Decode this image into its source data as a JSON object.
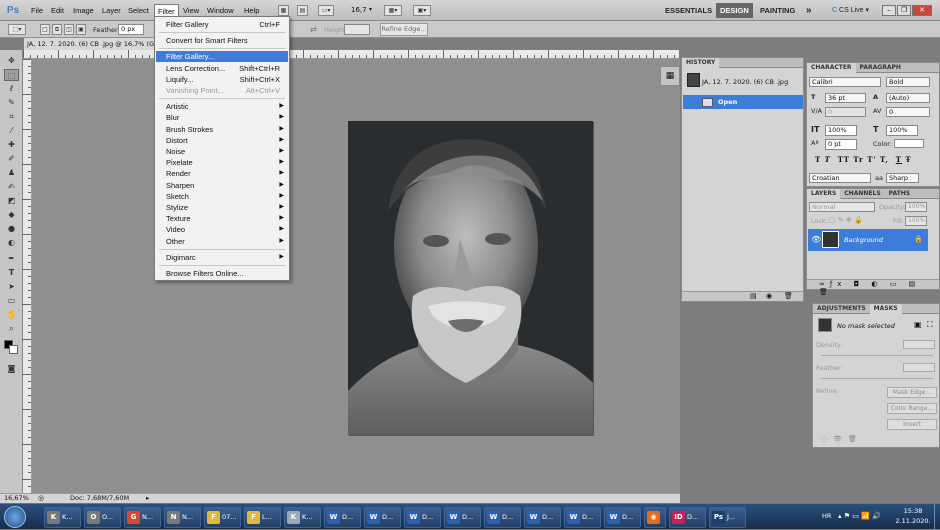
{
  "app": {
    "logo": "Ps"
  },
  "menu": [
    "File",
    "Edit",
    "Image",
    "Layer",
    "Select",
    "Filter",
    "View",
    "Window",
    "Help"
  ],
  "menu_active": "Filter",
  "toolbar_top": {
    "zoom": "16,7",
    "workspaces": [
      "ESSENTIALS",
      "DESIGN",
      "PAINTING"
    ],
    "active_workspace": "DESIGN",
    "more": "»",
    "cs_live": "CS Live"
  },
  "options": {
    "feather_label": "Feather:",
    "feather_value": "0 px",
    "height_label": "Height:",
    "refine_edge": "Refine Edge..."
  },
  "document": {
    "tab_title": "JA, 12. 7. 2020. (6) CB .jpg @ 16,7% (Gray/8)"
  },
  "filter_menu": [
    {
      "label": "Filter Gallery",
      "shortcut": "Ctrl+F"
    },
    {
      "sep": true
    },
    {
      "label": "Convert for Smart Filters"
    },
    {
      "sep": true
    },
    {
      "label": "Filter Gallery...",
      "highlight": true
    },
    {
      "label": "Lens Correction...",
      "shortcut": "Shift+Ctrl+R"
    },
    {
      "label": "Liquify...",
      "shortcut": "Shift+Ctrl+X"
    },
    {
      "label": "Vanishing Point...",
      "shortcut": "Alt+Ctrl+V",
      "disabled": true
    },
    {
      "sep": true
    },
    {
      "label": "Artistic",
      "sub": true
    },
    {
      "label": "Blur",
      "sub": true
    },
    {
      "label": "Brush Strokes",
      "sub": true
    },
    {
      "label": "Distort",
      "sub": true
    },
    {
      "label": "Noise",
      "sub": true
    },
    {
      "label": "Pixelate",
      "sub": true
    },
    {
      "label": "Render",
      "sub": true
    },
    {
      "label": "Sharpen",
      "sub": true
    },
    {
      "label": "Sketch",
      "sub": true
    },
    {
      "label": "Stylize",
      "sub": true
    },
    {
      "label": "Texture",
      "sub": true
    },
    {
      "label": "Video",
      "sub": true
    },
    {
      "label": "Other",
      "sub": true
    },
    {
      "sep": true
    },
    {
      "label": "Digimarc",
      "sub": true
    },
    {
      "sep": true
    },
    {
      "label": "Browse Filters Online..."
    }
  ],
  "history": {
    "tab": "HISTORY",
    "snapshot": "JA, 12. 7. 2020. (6) CB .jpg",
    "state": "Open"
  },
  "character": {
    "tabs": [
      "CHARACTER",
      "PARAGRAPH"
    ],
    "font": "Calibri",
    "style": "Bold",
    "size": "36 pt",
    "leading": "(Auto)",
    "kerning": "0",
    "tracking": "0",
    "vscale": "100%",
    "hscale": "100%",
    "baseline": "0 pt",
    "color_label": "Color:",
    "typo_buttons": [
      "T",
      "T",
      "TT",
      "Tr",
      "T'",
      "T,",
      "T",
      "Ŧ"
    ],
    "language": "Croatian",
    "aa_label": "aa",
    "antialias": "Sharp"
  },
  "layers": {
    "tabs": [
      "LAYERS",
      "CHANNELS",
      "PATHS"
    ],
    "blend": "Normal",
    "opacity_label": "Opacity:",
    "opacity": "100%",
    "lock_label": "Lock:",
    "fill_label": "Fill:",
    "fill": "100%",
    "layer_name": "Background"
  },
  "masks": {
    "tabs": [
      "ADJUSTMENTS",
      "MASKS"
    ],
    "status": "No mask selected",
    "density": "Density:",
    "feather": "Feather:",
    "refine": "Refine:",
    "buttons": [
      "Mask Edge...",
      "Color Range...",
      "Invert"
    ]
  },
  "status": {
    "zoom": "16,67%",
    "doc": "Doc: 7,68M/7,60M"
  },
  "taskbar": {
    "items": [
      {
        "label": "K...",
        "icon": "K",
        "color": "#7a7a7a"
      },
      {
        "label": "O...",
        "icon": "O",
        "color": "#7a7a7a"
      },
      {
        "label": "N...",
        "icon": "G",
        "color": "#d64a35"
      },
      {
        "label": "N...",
        "icon": "N",
        "color": "#7a7a7a"
      },
      {
        "label": "07...",
        "icon": "F",
        "color": "#e0b93b"
      },
      {
        "label": "L...",
        "icon": "F",
        "color": "#e0b93b"
      },
      {
        "label": "K...",
        "icon": "K",
        "color": "#9ab"
      },
      {
        "label": "D...",
        "icon": "W",
        "color": "#2b5fb4"
      },
      {
        "label": "D...",
        "icon": "W",
        "color": "#2b5fb4"
      },
      {
        "label": "D...",
        "icon": "W",
        "color": "#2b5fb4"
      },
      {
        "label": "D...",
        "icon": "W",
        "color": "#2b5fb4"
      },
      {
        "label": "D...",
        "icon": "W",
        "color": "#2b5fb4"
      },
      {
        "label": "D...",
        "icon": "W",
        "color": "#2b5fb4"
      },
      {
        "label": "D...",
        "icon": "W",
        "color": "#2b5fb4"
      },
      {
        "label": "D...",
        "icon": "W",
        "color": "#2b5fb4"
      },
      {
        "label": "",
        "icon": "◉",
        "color": "#e66b1f"
      },
      {
        "label": "D...",
        "icon": "ID",
        "color": "#c2245a"
      },
      {
        "label": "J...",
        "icon": "Ps",
        "color": "#1b3f6e"
      }
    ],
    "lang": "HR",
    "time": "15:38",
    "date": "2.11.2020."
  }
}
